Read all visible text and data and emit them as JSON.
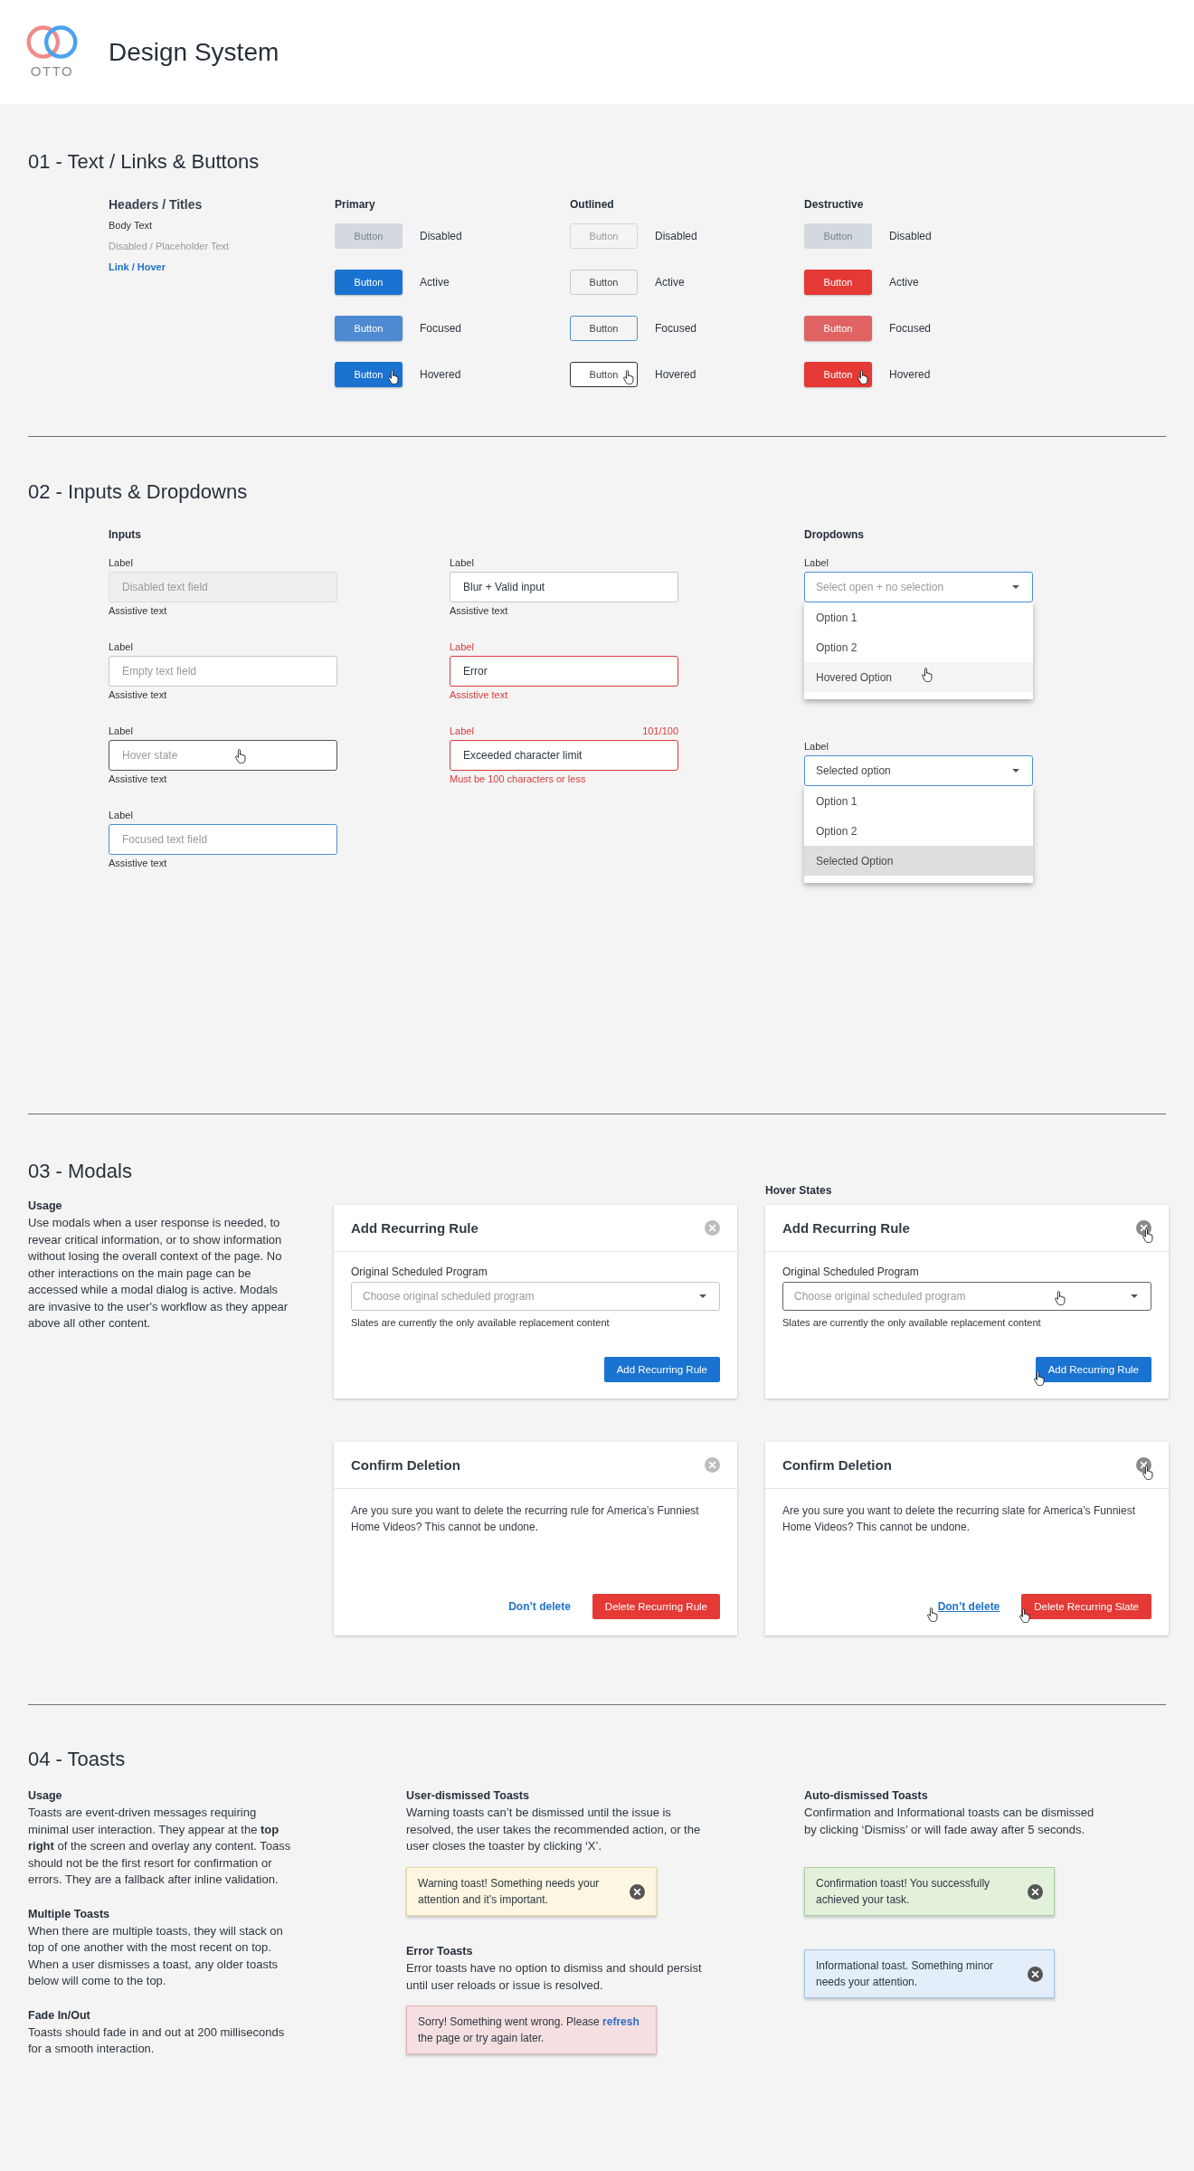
{
  "header": {
    "logo_text": "OTTO",
    "title": "Design System"
  },
  "text_and_buttons": {
    "title": "01 - Text / Links & Buttons",
    "text_styles": [
      {
        "kind": "header",
        "text": "Headers / Titles"
      },
      {
        "kind": "body",
        "text": "Body Text"
      },
      {
        "kind": "placeholder",
        "text": "Disabled / Placeholder Text"
      },
      {
        "kind": "link",
        "text": "Link / Hover"
      }
    ],
    "groups": [
      {
        "kind": "primary",
        "title": "Primary",
        "rows": [
          {
            "button": "Button",
            "label": "Disabled",
            "disabled": true,
            "focused": false,
            "hovered": false
          },
          {
            "button": "Button",
            "label": "Active",
            "disabled": false,
            "focused": false,
            "hovered": false
          },
          {
            "button": "Button",
            "label": "Focused",
            "disabled": false,
            "focused": true,
            "hovered": false
          },
          {
            "button": "Button",
            "label": "Hovered",
            "disabled": false,
            "focused": false,
            "hovered": true
          }
        ]
      },
      {
        "kind": "outlined",
        "title": "Outlined",
        "rows": [
          {
            "button": "Button",
            "label": "Disabled",
            "disabled": true,
            "focused": false,
            "hovered": false
          },
          {
            "button": "Button",
            "label": "Active",
            "disabled": false,
            "focused": false,
            "hovered": false
          },
          {
            "button": "Button",
            "label": "Focused",
            "disabled": false,
            "focused": true,
            "hovered": false
          },
          {
            "button": "Button",
            "label": "Hovered",
            "disabled": false,
            "focused": false,
            "hovered": true
          }
        ]
      },
      {
        "kind": "destructive",
        "title": "Destructive",
        "rows": [
          {
            "button": "Button",
            "label": "Disabled",
            "disabled": true,
            "focused": false,
            "hovered": false
          },
          {
            "button": "Button",
            "label": "Active",
            "disabled": false,
            "focused": false,
            "hovered": false
          },
          {
            "button": "Button",
            "label": "Focused",
            "disabled": false,
            "focused": true,
            "hovered": false
          },
          {
            "button": "Button",
            "label": "Hovered",
            "disabled": false,
            "focused": false,
            "hovered": true
          }
        ]
      }
    ]
  },
  "inputs_and_dropdowns": {
    "title": "02 - Inputs & Dropdowns",
    "inputs": {
      "title": "Inputs",
      "columns": [
        {
          "fields": [
            {
              "label": "Label",
              "placeholder": "Disabled text field",
              "assistive": "Assistive text",
              "disabled": true,
              "hovered": false,
              "focused": false,
              "error": false
            },
            {
              "label": "Label",
              "placeholder": "Empty text field",
              "assistive": "Assistive text",
              "disabled": false,
              "hovered": false,
              "focused": false,
              "error": false
            },
            {
              "label": "Label",
              "placeholder": "Hover state",
              "assistive": "Assistive text",
              "disabled": false,
              "hovered": true,
              "focused": false,
              "error": false
            },
            {
              "label": "Label",
              "placeholder": "Focused text field",
              "assistive": "Assistive text",
              "disabled": false,
              "hovered": false,
              "focused": true,
              "error": false
            }
          ]
        },
        {
          "fields": [
            {
              "label": "Label",
              "value": "Blur + Valid input",
              "assistive": "Assistive text",
              "disabled": false,
              "hovered": false,
              "focused": false,
              "error": false
            },
            {
              "label": "Label",
              "value": "Error",
              "assistive": "Assistive text",
              "disabled": false,
              "hovered": false,
              "focused": false,
              "error": true
            },
            {
              "label": "Label",
              "counter": "101/100",
              "value": "Exceeded character limit",
              "assistive": "Must be 100 characters or less",
              "disabled": false,
              "hovered": false,
              "focused": false,
              "error": true
            }
          ]
        }
      ]
    },
    "dropdowns": {
      "title": "Dropdowns",
      "items": [
        {
          "label": "Label",
          "placeholder": "Select open + no selection",
          "expanded": true,
          "options": [
            {
              "text": "Option 1",
              "hovered": false,
              "selected": false
            },
            {
              "text": "Option 2",
              "hovered": false,
              "selected": false
            },
            {
              "text": "Hovered Option",
              "hovered": true,
              "selected": false
            }
          ]
        },
        {
          "label": "Label",
          "value": "Selected option",
          "expanded": true,
          "options": [
            {
              "text": "Option 1",
              "hovered": false,
              "selected": false
            },
            {
              "text": "Option 2",
              "hovered": false,
              "selected": false
            },
            {
              "text": "Selected Option",
              "hovered": false,
              "selected": true
            }
          ]
        }
      ]
    }
  },
  "modals": {
    "title": "03 - Modals",
    "usage": {
      "title": "Usage",
      "text": "Use modals when a user response is needed, to revear critical information, or to show information without losing the overall context of the page. No other interactions on the main page can be accessed while a modal dialog is active. Modals are invasive to the user's workflow as they appear above all other content."
    },
    "hover_title": "Hover States",
    "items": [
      {
        "kind": "form",
        "hovered": false,
        "title": "Add Recurring Rule",
        "field_label": "Original Scheduled Program",
        "placeholder": "Choose original scheduled program",
        "hint": "Slates are currently the only available replacement content",
        "action": "Add Recurring Rule"
      },
      {
        "kind": "form",
        "hovered": true,
        "title": "Add Recurring Rule",
        "field_label": "Original Scheduled Program",
        "placeholder": "Choose original scheduled program",
        "hint": "Slates are currently the only available replacement content",
        "action": "Add Recurring Rule"
      },
      {
        "kind": "confirm",
        "hovered": false,
        "title": "Confirm Deletion",
        "message": "Are you sure you want to delete the recurring rule for America’s Funniest Home Videos? This cannot be undone.",
        "cancel": "Don’t delete",
        "action": "Delete Recurring Rule"
      },
      {
        "kind": "confirm",
        "hovered": true,
        "title": "Confirm Deletion",
        "message": "Are you sure you want to delete the recurring slate for America’s Funniest Home Videos? This cannot be undone.",
        "cancel": "Don’t delete",
        "action": "Delete Recurring Slate"
      }
    ]
  },
  "toasts": {
    "title": "04 - Toasts",
    "columns": [
      {
        "blocks": [
          {
            "title": "Usage",
            "text": "Toasts are event-driven messages requiring minimal user interaction. They appear at the **top right** of the screen and overlay any content. Toass should not be the first resort for confirmation or errors. They are a fallback after inline validation."
          },
          {
            "title": "Multiple Toasts",
            "text": "When there are multiple toasts, they will stack on top of one another with the most recent on top. When a user dismisses a toast, any older toasts below will come to the top."
          },
          {
            "title": "Fade In/Out",
            "text": "Toasts should fade in and out at 200 milliseconds for a smooth interaction."
          }
        ]
      },
      {
        "blocks": [
          {
            "title": "User-dismissed Toasts",
            "text": "Warning toasts can’t be dismissed until the issue is resolved, the user takes the recommended action, or the user closes the toaster by clicking ‘X’.",
            "toasts": [
              {
                "kind": "warning",
                "dismissible": true,
                "text": "Warning toast! Something needs your attention and it’s important."
              }
            ]
          },
          {
            "title": "Error Toasts",
            "text": "Error toasts have no option to dismiss and should persist until user reloads or issue is resolved.",
            "toasts": [
              {
                "kind": "error",
                "dismissible": false,
                "text": "Sorry! Something went wrong. Please ",
                "link": "refresh",
                "text_after": " the page or try again later."
              }
            ]
          }
        ]
      },
      {
        "blocks": [
          {
            "title": "Auto-dismissed Toasts",
            "text": "Confirmation and Informational toasts can be dismissed by clicking ‘Dismiss’ or will fade away after 5 seconds.",
            "toasts": [
              {
                "kind": "confirmation",
                "dismissible": true,
                "text": "Confirmation toast! You successfully achieved your task."
              },
              {
                "kind": "info",
                "dismissible": true,
                "text": "Informational toast. Something minor needs your attention."
              }
            ]
          }
        ]
      }
    ]
  }
}
